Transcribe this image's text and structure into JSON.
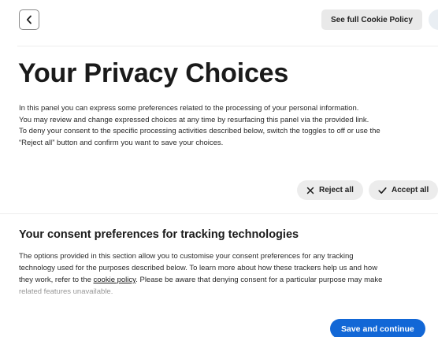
{
  "header": {
    "back_icon": "chevron-left-icon",
    "cookie_policy_label": "See full Cookie Policy"
  },
  "intro": {
    "title": "Your Privacy Choices",
    "lines": [
      "In this panel you can express some preferences related to the processing of your personal information.",
      "You may review and change expressed choices at any time by resurfacing this panel via the provided link.",
      "To deny your consent to the specific processing activities described below, switch the toggles to off or use the",
      "“Reject all” button and confirm you want to save your choices."
    ]
  },
  "actions": {
    "reject_label": "Reject all",
    "reject_icon": "close-icon",
    "accept_label": "Accept all",
    "accept_icon": "checkmark-icon"
  },
  "tracking": {
    "title": "Your consent preferences for tracking technologies",
    "line1": "The options provided in this section allow you to customise your consent preferences for any tracking",
    "line2": "technology used for the purposes described below. To learn more about how these trackers help us and how",
    "line3_before": "they work, refer to the ",
    "line3_link": "cookie policy",
    "line3_after": ". Please be aware that denying consent for a particular purpose may make",
    "line4": "related features unavailable."
  },
  "footer": {
    "save_label": "Save and continue"
  },
  "colors": {
    "primary": "#1267d6",
    "pill_bg": "#ececec",
    "text": "#1f1f1f"
  }
}
